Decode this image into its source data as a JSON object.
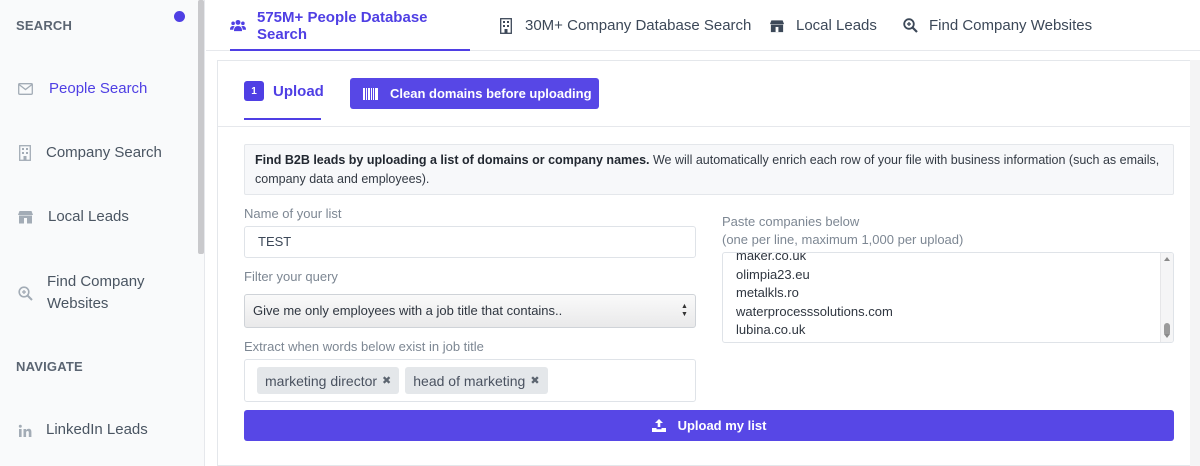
{
  "sidebar": {
    "section_search": "SEARCH",
    "section_navigate": "NAVIGATE",
    "items": [
      {
        "label": "People Search",
        "icon": "envelope-icon"
      },
      {
        "label": "Company Search",
        "icon": "building-icon"
      },
      {
        "label": "Local Leads",
        "icon": "shop-icon"
      },
      {
        "label": "Find Company Websites",
        "icon": "search-plus-icon"
      },
      {
        "label": "LinkedIn Leads",
        "icon": "linkedin-icon"
      }
    ]
  },
  "tabs": [
    {
      "label": "575M+ People Database Search",
      "icon": "users-icon"
    },
    {
      "label": "30M+ Company Database Search",
      "icon": "building-icon"
    },
    {
      "label": "Local Leads",
      "icon": "shop-icon"
    },
    {
      "label": "Find Company Websites",
      "icon": "search-plus-icon"
    }
  ],
  "card": {
    "step_number": "1",
    "upload_tab": "Upload",
    "clean_button": "Clean domains before uploading",
    "info_bold": "Find B2B leads by uploading a list of domains or company names.",
    "info_rest": " We will automatically enrich each row of your file with business information (such as emails, company data and employees).",
    "list_name_label": "Name of your list",
    "list_name_value": "TEST",
    "filter_label": "Filter your query",
    "filter_value": "Give me only employees with a job title that contains..",
    "extract_label": "Extract when words below exist in job title",
    "tags": [
      "marketing director",
      "head of marketing"
    ],
    "paste_label_1": "Paste companies below",
    "paste_label_2": "(one per line, maximum 1,000 per upload)",
    "companies": [
      "maker.co.uk",
      "olimpia23.eu",
      "metalkls.ro",
      "waterprocesssolutions.com",
      "lubina.co.uk"
    ],
    "submit_button": "Upload my list"
  },
  "colors": {
    "accent": "#4f3fe4",
    "button": "#5747e6"
  }
}
